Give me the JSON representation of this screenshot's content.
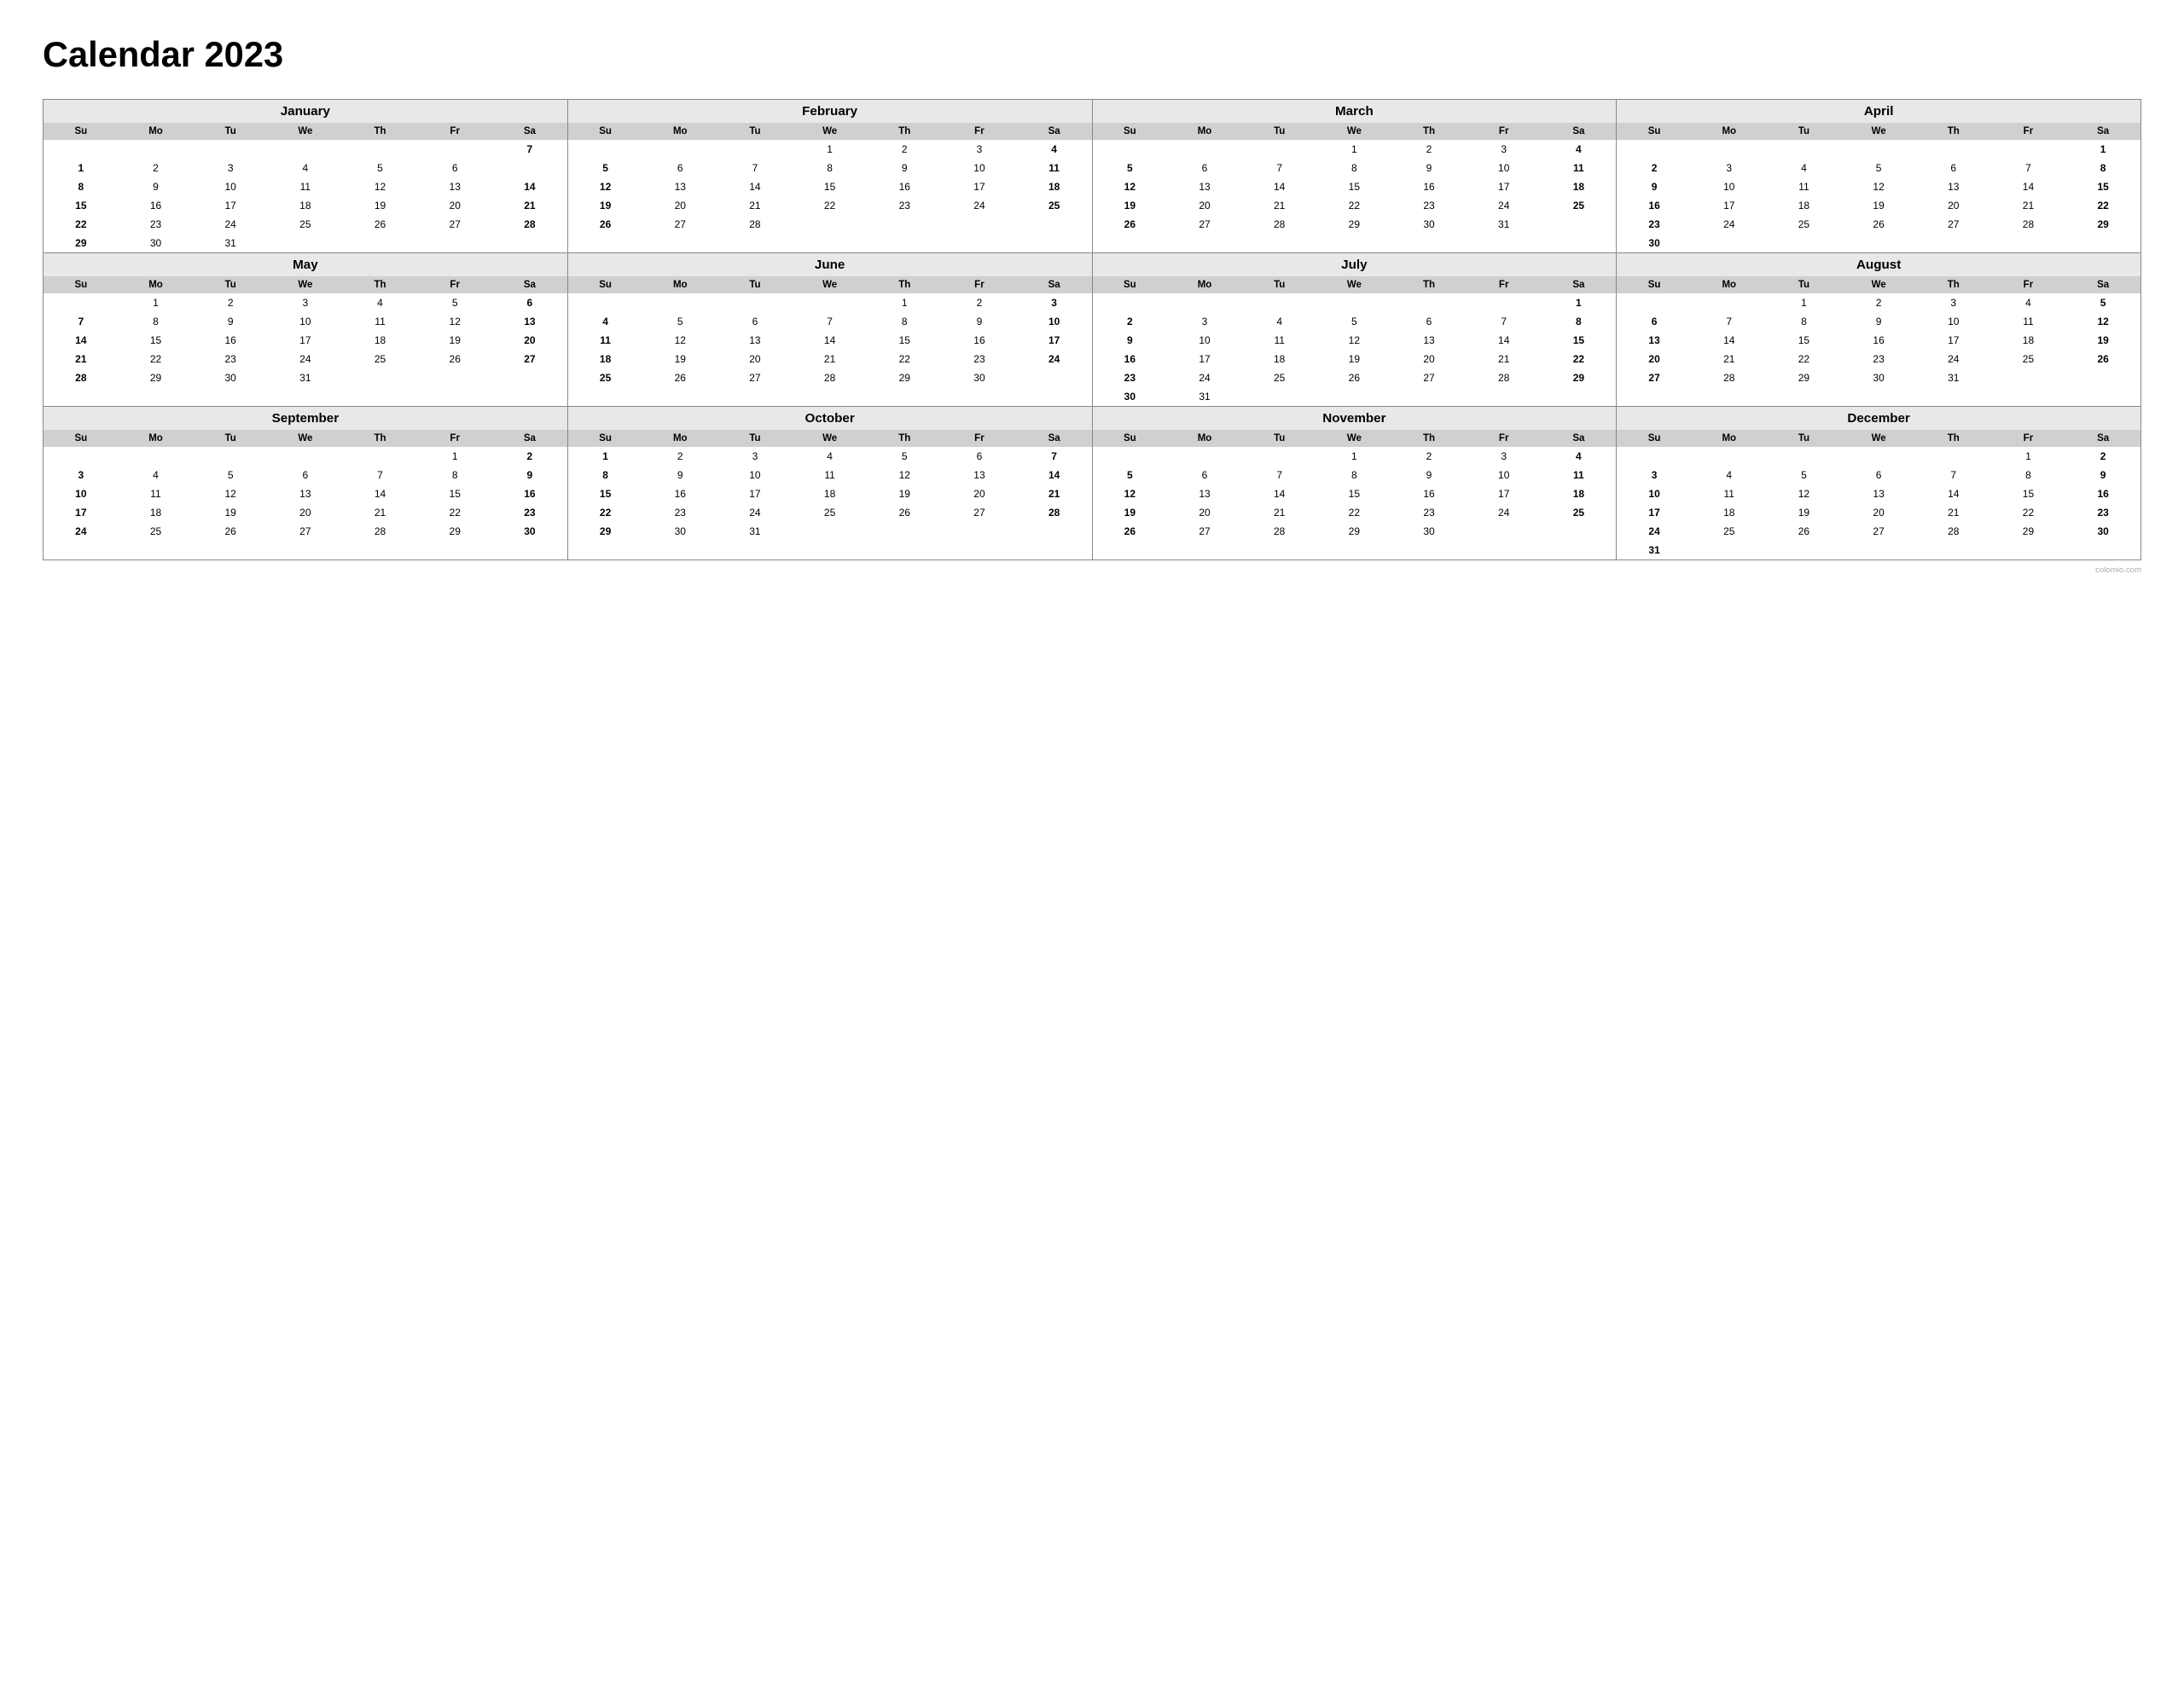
{
  "title": "Calendar 2023",
  "footer": "colomio.com",
  "months": [
    {
      "name": "January",
      "days": [
        [
          null,
          null,
          null,
          null,
          null,
          null,
          7
        ],
        [
          1,
          2,
          3,
          4,
          5,
          6,
          null
        ],
        [
          8,
          9,
          10,
          11,
          12,
          13,
          14
        ],
        [
          15,
          16,
          17,
          18,
          19,
          20,
          21
        ],
        [
          22,
          23,
          24,
          25,
          26,
          27,
          28
        ],
        [
          29,
          30,
          31,
          null,
          null,
          null,
          null
        ]
      ],
      "startDay": 0
    },
    {
      "name": "February",
      "days": [
        [
          null,
          null,
          null,
          1,
          2,
          3,
          4
        ],
        [
          5,
          6,
          7,
          8,
          9,
          10,
          11
        ],
        [
          12,
          13,
          14,
          15,
          16,
          17,
          18
        ],
        [
          19,
          20,
          21,
          22,
          23,
          24,
          25
        ],
        [
          26,
          27,
          28,
          null,
          null,
          null,
          null
        ]
      ],
      "startDay": 3
    },
    {
      "name": "March",
      "days": [
        [
          null,
          null,
          null,
          1,
          2,
          3,
          4
        ],
        [
          5,
          6,
          7,
          8,
          9,
          10,
          11
        ],
        [
          12,
          13,
          14,
          15,
          16,
          17,
          18
        ],
        [
          19,
          20,
          21,
          22,
          23,
          24,
          25
        ],
        [
          26,
          27,
          28,
          29,
          30,
          31,
          null
        ]
      ]
    },
    {
      "name": "April",
      "days": [
        [
          null,
          null,
          null,
          null,
          null,
          null,
          1
        ],
        [
          2,
          3,
          4,
          5,
          6,
          7,
          8
        ],
        [
          9,
          10,
          11,
          12,
          13,
          14,
          15
        ],
        [
          16,
          17,
          18,
          19,
          20,
          21,
          22
        ],
        [
          23,
          24,
          25,
          26,
          27,
          28,
          29
        ],
        [
          30,
          null,
          null,
          null,
          null,
          null,
          null
        ]
      ]
    },
    {
      "name": "May",
      "days": [
        [
          null,
          1,
          2,
          3,
          4,
          5,
          6
        ],
        [
          7,
          8,
          9,
          10,
          11,
          12,
          13
        ],
        [
          14,
          15,
          16,
          17,
          18,
          19,
          20
        ],
        [
          21,
          22,
          23,
          24,
          25,
          26,
          27
        ],
        [
          28,
          29,
          30,
          31,
          null,
          null,
          null
        ]
      ]
    },
    {
      "name": "June",
      "days": [
        [
          null,
          null,
          null,
          null,
          1,
          2,
          3
        ],
        [
          4,
          5,
          6,
          7,
          8,
          9,
          10
        ],
        [
          11,
          12,
          13,
          14,
          15,
          16,
          17
        ],
        [
          18,
          19,
          20,
          21,
          22,
          23,
          24
        ],
        [
          25,
          26,
          27,
          28,
          29,
          30,
          null
        ]
      ]
    },
    {
      "name": "July",
      "days": [
        [
          null,
          null,
          null,
          null,
          null,
          null,
          1
        ],
        [
          2,
          3,
          4,
          5,
          6,
          7,
          8
        ],
        [
          9,
          10,
          11,
          12,
          13,
          14,
          15
        ],
        [
          16,
          17,
          18,
          19,
          20,
          21,
          22
        ],
        [
          23,
          24,
          25,
          26,
          27,
          28,
          29
        ],
        [
          30,
          31,
          null,
          null,
          null,
          null,
          null
        ]
      ]
    },
    {
      "name": "August",
      "days": [
        [
          null,
          null,
          1,
          2,
          3,
          4,
          5
        ],
        [
          6,
          7,
          8,
          9,
          10,
          11,
          12
        ],
        [
          13,
          14,
          15,
          16,
          17,
          18,
          19
        ],
        [
          20,
          21,
          22,
          23,
          24,
          25,
          26
        ],
        [
          27,
          28,
          29,
          30,
          31,
          null,
          null
        ]
      ]
    },
    {
      "name": "September",
      "days": [
        [
          null,
          null,
          null,
          null,
          null,
          1,
          2
        ],
        [
          3,
          4,
          5,
          6,
          7,
          8,
          9
        ],
        [
          10,
          11,
          12,
          13,
          14,
          15,
          16
        ],
        [
          17,
          18,
          19,
          20,
          21,
          22,
          23
        ],
        [
          24,
          25,
          26,
          27,
          28,
          29,
          30
        ]
      ]
    },
    {
      "name": "October",
      "days": [
        [
          1,
          2,
          3,
          4,
          5,
          6,
          7
        ],
        [
          8,
          9,
          10,
          11,
          12,
          13,
          14
        ],
        [
          15,
          16,
          17,
          18,
          19,
          20,
          21
        ],
        [
          22,
          23,
          24,
          25,
          26,
          27,
          28
        ],
        [
          29,
          30,
          31,
          null,
          null,
          null,
          null
        ]
      ]
    },
    {
      "name": "November",
      "days": [
        [
          null,
          null,
          null,
          1,
          2,
          3,
          4
        ],
        [
          5,
          6,
          7,
          8,
          9,
          10,
          11
        ],
        [
          12,
          13,
          14,
          15,
          16,
          17,
          18
        ],
        [
          19,
          20,
          21,
          22,
          23,
          24,
          25
        ],
        [
          26,
          27,
          28,
          29,
          30,
          null,
          null
        ]
      ]
    },
    {
      "name": "December",
      "days": [
        [
          null,
          null,
          null,
          null,
          null,
          1,
          2
        ],
        [
          3,
          4,
          5,
          6,
          7,
          8,
          9
        ],
        [
          10,
          11,
          12,
          13,
          14,
          15,
          16
        ],
        [
          17,
          18,
          19,
          20,
          21,
          22,
          23
        ],
        [
          24,
          25,
          26,
          27,
          28,
          29,
          30
        ],
        [
          31,
          null,
          null,
          null,
          null,
          null,
          null
        ]
      ]
    }
  ],
  "weekdays": [
    "Su",
    "Mo",
    "Tu",
    "We",
    "Th",
    "Fr",
    "Sa"
  ]
}
